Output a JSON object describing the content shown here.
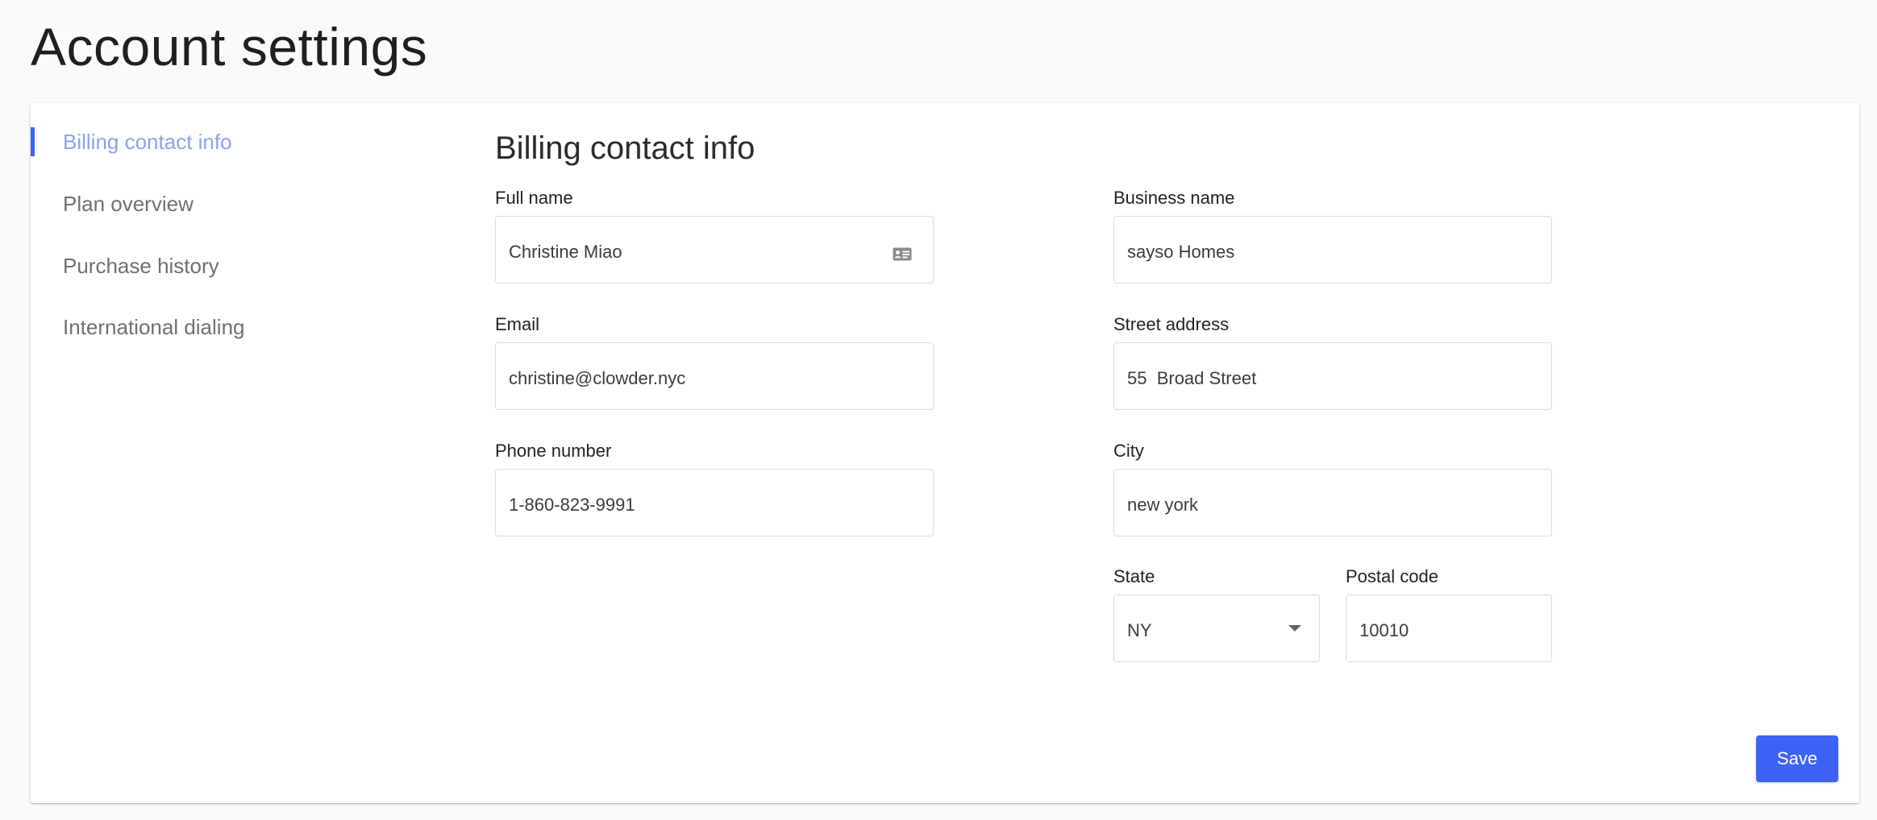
{
  "page": {
    "title": "Account settings"
  },
  "nav": {
    "items": [
      {
        "label": "Billing contact info",
        "active": true
      },
      {
        "label": "Plan overview",
        "active": false
      },
      {
        "label": "Purchase history",
        "active": false
      },
      {
        "label": "International dialing",
        "active": false
      }
    ]
  },
  "section": {
    "title": "Billing contact info"
  },
  "form": {
    "full_name": {
      "label": "Full name",
      "value": "Christine Miao",
      "icon": "contact-card-icon"
    },
    "email": {
      "label": "Email",
      "value": "christine@clowder.nyc"
    },
    "phone": {
      "label": "Phone number",
      "value": "1-860-823-9991"
    },
    "business_name": {
      "label": "Business name",
      "value": "sayso Homes"
    },
    "street_address": {
      "label": "Street address",
      "value": "55  Broad Street"
    },
    "city": {
      "label": "City",
      "value": "new york"
    },
    "state": {
      "label": "State",
      "value": "NY",
      "icon": "caret-down-icon"
    },
    "postal_code": {
      "label": "Postal code",
      "value": "10010"
    }
  },
  "actions": {
    "save_label": "Save"
  },
  "colors": {
    "accent": "#3d63f5",
    "active_nav_text": "#8aa2f0",
    "field_border": "#dcdcdc"
  }
}
